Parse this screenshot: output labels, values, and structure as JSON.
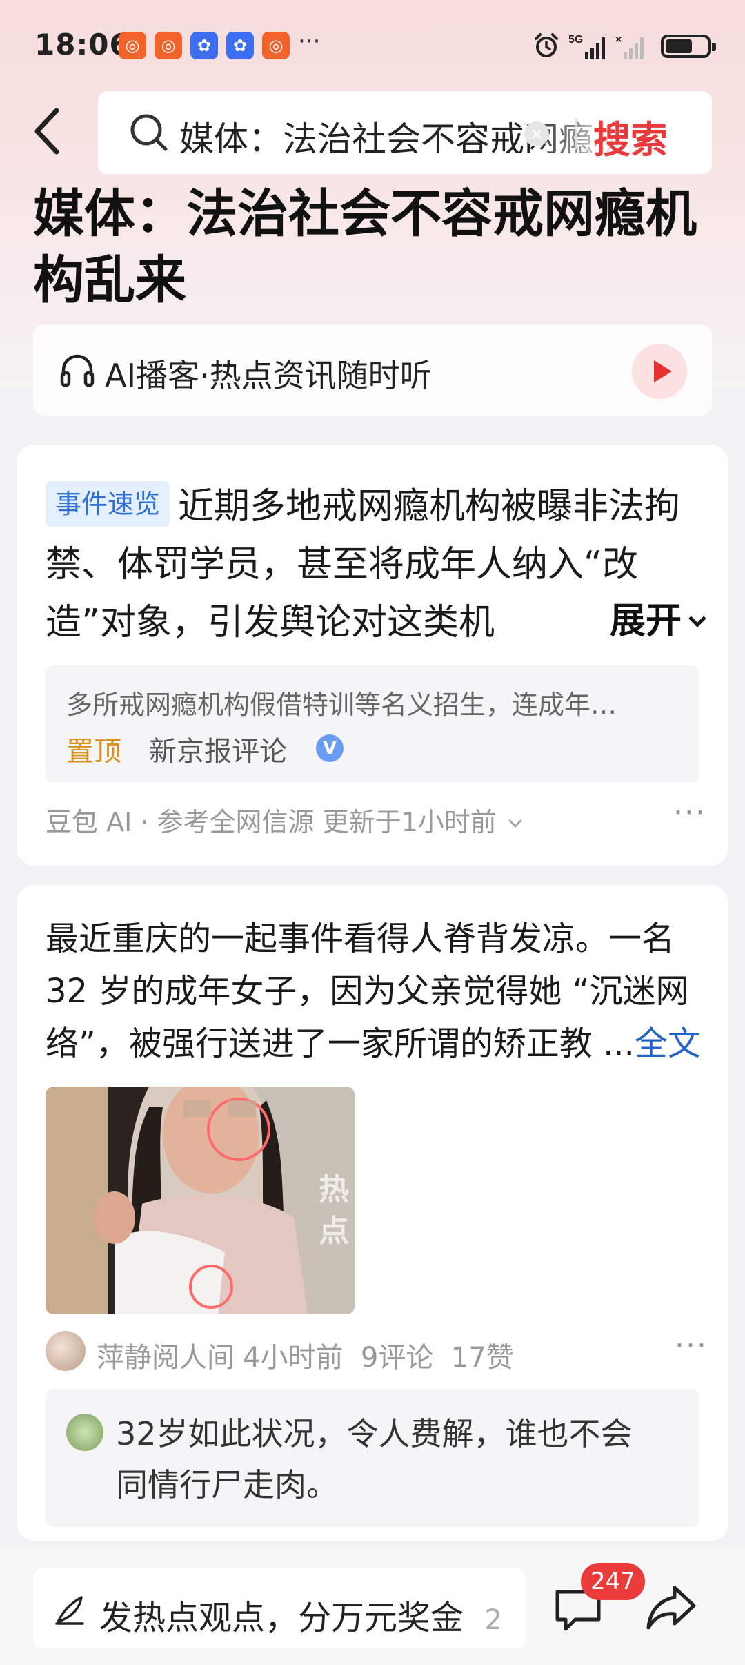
{
  "status_bar": {
    "time": "18:06",
    "more": "···",
    "network": "5G",
    "app_icons": [
      "app-icon-orange",
      "app-icon-orange",
      "app-icon-blue",
      "app-icon-blue",
      "app-icon-orange"
    ]
  },
  "header": {
    "search_query": "媒体：法治社会不容戒网瘾机构乱来",
    "clear_icon": "×",
    "search_button": "搜索"
  },
  "article": {
    "title": "媒体：法治社会不容戒网瘾机构乱来"
  },
  "podcast": {
    "label": "AI播客·热点资讯随时听"
  },
  "summary_card": {
    "badge": "事件速览",
    "text": "近期多地戒网瘾机构被曝非法拘禁、体罚学员，甚至将成年人纳入“改造”对象，引发舆论对这类机",
    "expand_label": "展开",
    "reference": {
      "text": "多所戒网瘾机构假借特训等名义招生，连成年…",
      "pin_label": "置顶",
      "source": "新京报评论",
      "verified": "V"
    },
    "footer": "豆包 AI · 参考全网信源  更新于1小时前",
    "more": "···"
  },
  "post_card": {
    "text": "最近重庆的一起事件看得人脊背发凉。一名 32 岁的成年女子，因为父亲觉得她 “沉迷网络”，被强行送进了一家所谓的矫正教 ...",
    "fulltext_label": "全文",
    "image_watermark": "热点",
    "author": "萍静阅人间",
    "time": "4小时前",
    "comments": "9评论",
    "likes": "17赞",
    "more": "···",
    "top_comment": "32岁如此状况，令人费解，谁也不会同情行尸走肉。"
  },
  "bottom_bar": {
    "compose_text": "发热点观点，分万元奖金",
    "compose_suffix": "2..",
    "comment_count": "247"
  },
  "colors": {
    "accent_red": "#e83a3a",
    "link_blue": "#2062c8",
    "badge_blue": "#2f6fd6",
    "pin_orange": "#d9911c"
  }
}
